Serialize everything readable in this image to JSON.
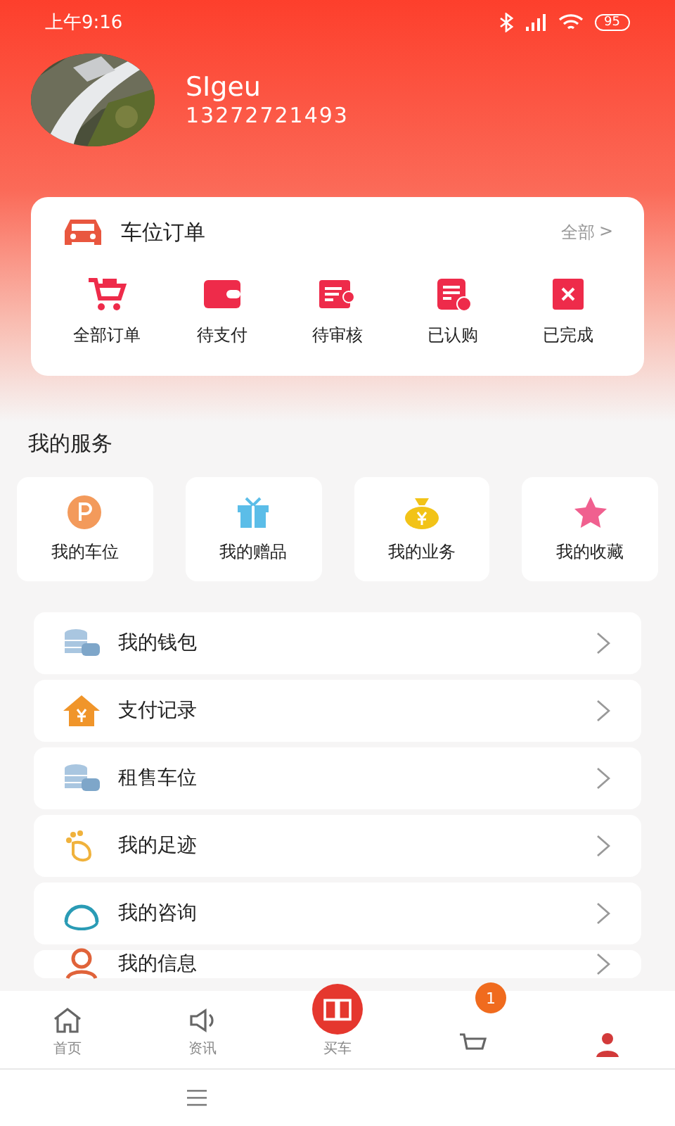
{
  "status_bar": {
    "time": "上午9:16",
    "battery": "95"
  },
  "profile": {
    "name": "SIgeu",
    "phone": "13272721493"
  },
  "orders": {
    "title": "车位订单",
    "more": "全部",
    "more_arrow": ">",
    "items": [
      {
        "kind": "cart",
        "label": "全部订单"
      },
      {
        "kind": "wallet",
        "label": "待支付"
      },
      {
        "kind": "review",
        "label": "待审核"
      },
      {
        "kind": "bought",
        "label": "已认购"
      },
      {
        "kind": "done",
        "label": "已完成"
      }
    ]
  },
  "services": {
    "title": "我的服务",
    "items": [
      {
        "kind": "parking",
        "label": "我的车位"
      },
      {
        "kind": "gift",
        "label": "我的赠品"
      },
      {
        "kind": "money",
        "label": "我的业务"
      },
      {
        "kind": "star",
        "label": "我的收藏"
      }
    ]
  },
  "menu": [
    {
      "kind": "coins",
      "label": "我的钱包"
    },
    {
      "kind": "house",
      "label": "支付记录"
    },
    {
      "kind": "coins",
      "label": "租售车位"
    },
    {
      "kind": "foot",
      "label": "我的足迹"
    },
    {
      "kind": "headset",
      "label": "我的咨询"
    },
    {
      "kind": "person",
      "label": "我的信息"
    }
  ],
  "tab_bar": [
    {
      "kind": "home",
      "label": "首页"
    },
    {
      "kind": "speaker",
      "label": "资讯"
    },
    {
      "kind": "book",
      "label": "买车"
    },
    {
      "kind": "cart",
      "badge": "1"
    },
    {
      "kind": "person"
    }
  ]
}
